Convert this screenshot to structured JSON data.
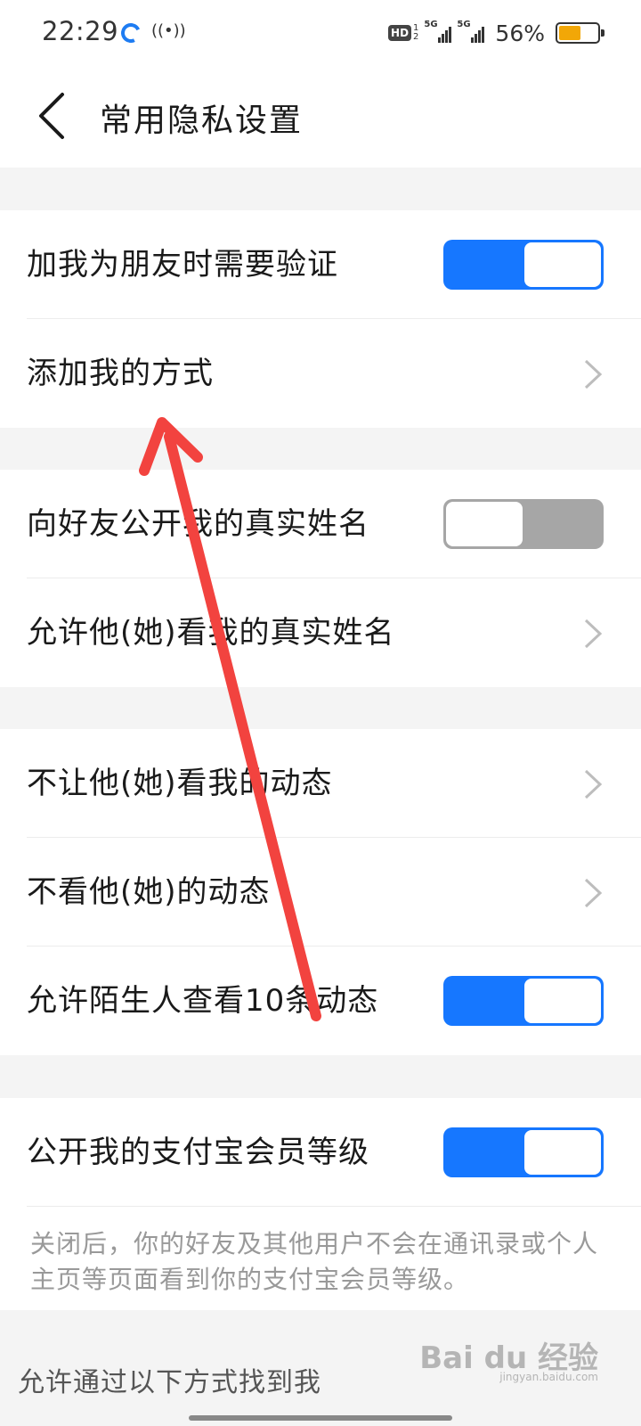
{
  "status_bar": {
    "time": "22:29",
    "hd_label": "HD",
    "hd_sub_top": "1",
    "hd_sub_bottom": "2",
    "signal_1_label": "5G",
    "signal_2_label": "5G",
    "battery_percent": "56%",
    "battery_level": 0.56,
    "battery_color": "#f2a707"
  },
  "header": {
    "title": "常用隐私设置",
    "back_icon": "chevron-left-icon"
  },
  "groups": [
    {
      "items": [
        {
          "label": "加我为朋友时需要验证",
          "type": "toggle",
          "on": true
        },
        {
          "label": "添加我的方式",
          "type": "link"
        }
      ]
    },
    {
      "items": [
        {
          "label": "向好友公开我的真实姓名",
          "type": "toggle",
          "on": false
        },
        {
          "label": "允许他(她)看我的真实姓名",
          "type": "link"
        }
      ]
    },
    {
      "items": [
        {
          "label": "不让他(她)看我的动态",
          "type": "link"
        },
        {
          "label": "不看他(她)的动态",
          "type": "link"
        },
        {
          "label": "允许陌生人查看10条动态",
          "type": "toggle",
          "on": true
        }
      ]
    },
    {
      "items": [
        {
          "label": "公开我的支付宝会员等级",
          "type": "toggle",
          "on": true
        }
      ],
      "hint": "关闭后，你的好友及其他用户不会在通讯录或个人主页等页面看到你的支付宝会员等级。"
    }
  ],
  "section_header": "允许通过以下方式找到我",
  "watermark": {
    "text": "Bai du 经验",
    "sub": "jingyan.baidu.com"
  },
  "colors": {
    "toggle_on": "#1677ff",
    "toggle_off": "#a6a6a6",
    "annotation_arrow": "#f2433f"
  }
}
